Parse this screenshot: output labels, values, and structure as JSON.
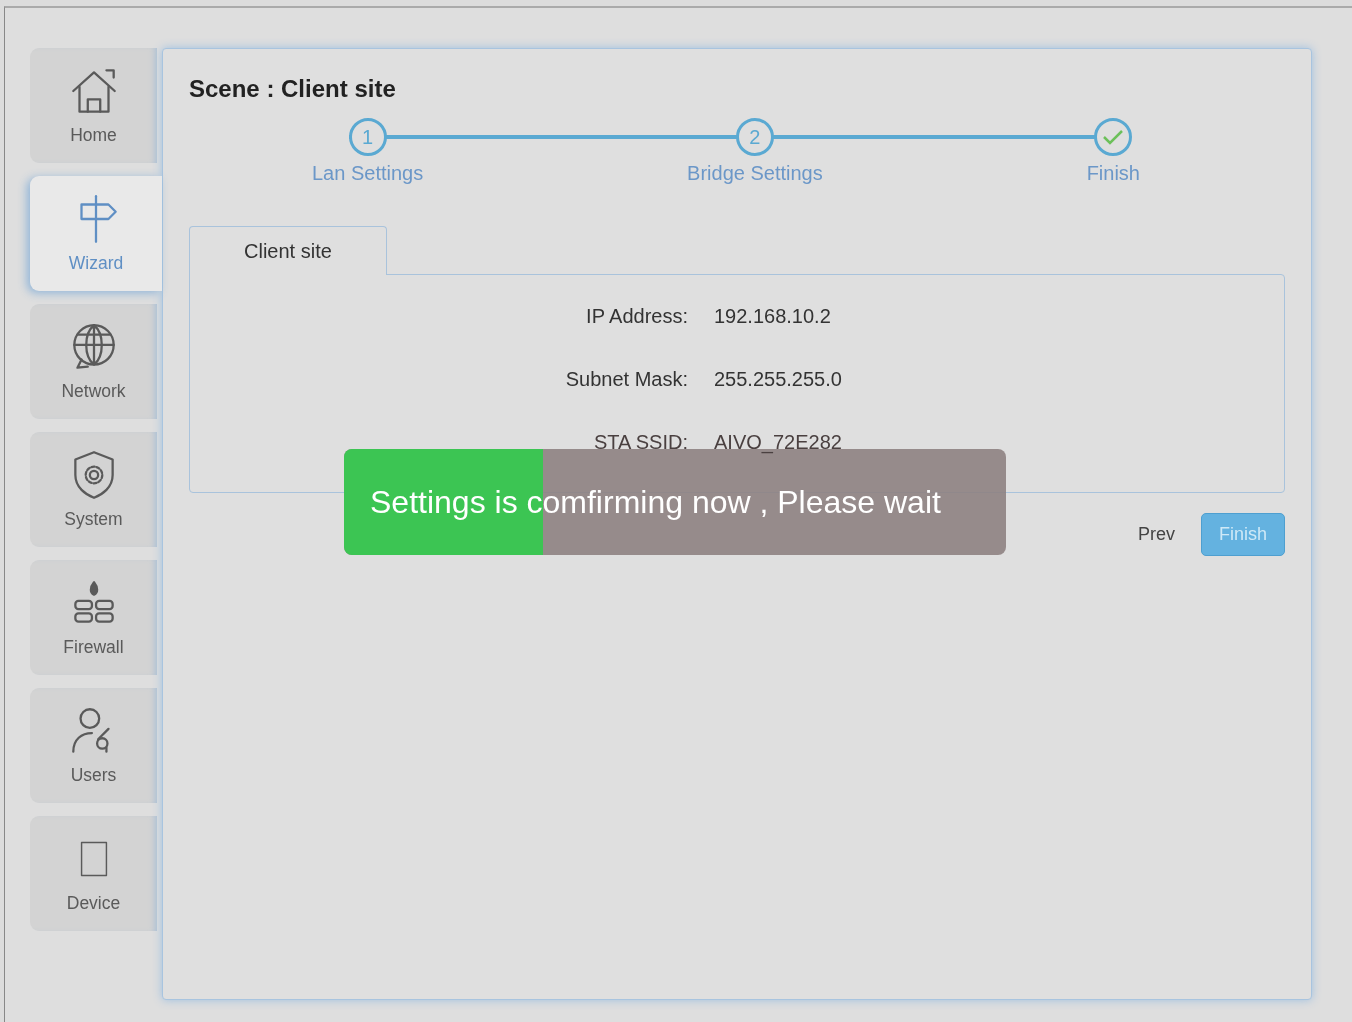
{
  "sidebar": {
    "items": [
      {
        "label": "Home",
        "selected": false
      },
      {
        "label": "Wizard",
        "selected": true
      },
      {
        "label": "Network",
        "selected": false
      },
      {
        "label": "System",
        "selected": false
      },
      {
        "label": "Firewall",
        "selected": false
      },
      {
        "label": "Users",
        "selected": false
      },
      {
        "label": "Device",
        "selected": false
      }
    ]
  },
  "title": "Scene : Client site",
  "steps": [
    {
      "kind": "number",
      "number": "1",
      "label": "Lan Settings"
    },
    {
      "kind": "number",
      "number": "2",
      "label": "Bridge Settings"
    },
    {
      "kind": "check",
      "label": "Finish"
    }
  ],
  "tabs": [
    {
      "label": "Client site"
    }
  ],
  "fields": [
    {
      "label": "IP Address:",
      "value": "192.168.10.2"
    },
    {
      "label": "Subnet Mask:",
      "value": "255.255.255.0"
    },
    {
      "label": "STA SSID:",
      "value": "AIVO_72E282"
    }
  ],
  "buttons": [
    {
      "kind": "link",
      "label": "Prev"
    },
    {
      "kind": "primary",
      "label": "Finish"
    }
  ],
  "progress": {
    "message": "Settings is comfirming now , Please wait",
    "level": 0.3
  }
}
